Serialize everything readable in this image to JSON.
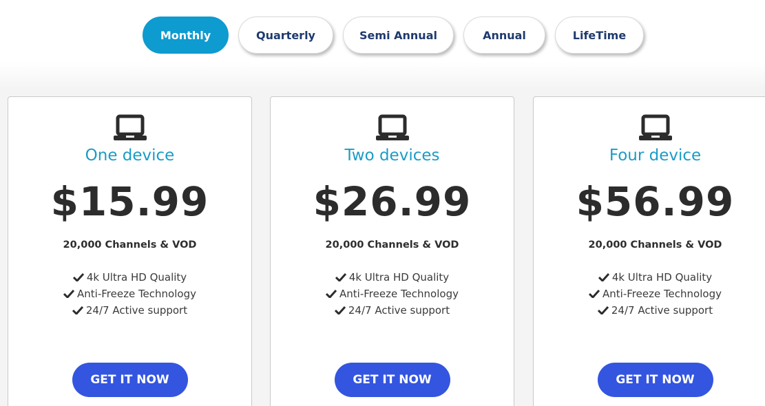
{
  "tabs": [
    {
      "label": "Monthly",
      "active": true
    },
    {
      "label": "Quarterly",
      "active": false
    },
    {
      "label": "Semi Annual",
      "active": false
    },
    {
      "label": "Annual",
      "active": false
    },
    {
      "label": "LifeTime",
      "active": false
    }
  ],
  "plans": [
    {
      "icon": "laptop-icon",
      "name": "One device",
      "price": "$15.99",
      "channels": "20,000 Channels & VOD",
      "features": [
        "4k Ultra HD Quality",
        "Anti-Freeze Technology",
        "24/7 Active support"
      ],
      "cta": "GET IT NOW"
    },
    {
      "icon": "laptop-icon",
      "name": "Two devices",
      "price": "$26.99",
      "channels": "20,000 Channels & VOD",
      "features": [
        "4k Ultra HD Quality",
        "Anti-Freeze Technology",
        "24/7 Active support"
      ],
      "cta": "GET IT NOW"
    },
    {
      "icon": "laptop-icon",
      "name": "Four device",
      "price": "$56.99",
      "channels": "20,000 Channels & VOD",
      "features": [
        "4k Ultra HD Quality",
        "Anti-Freeze Technology",
        "24/7 Active support"
      ],
      "cta": "GET IT NOW"
    }
  ],
  "colors": {
    "accent": "#0e9bd0",
    "plan_name": "#1a9cc6",
    "cta": "#3355e0",
    "tab_text": "#1e3a6e"
  }
}
